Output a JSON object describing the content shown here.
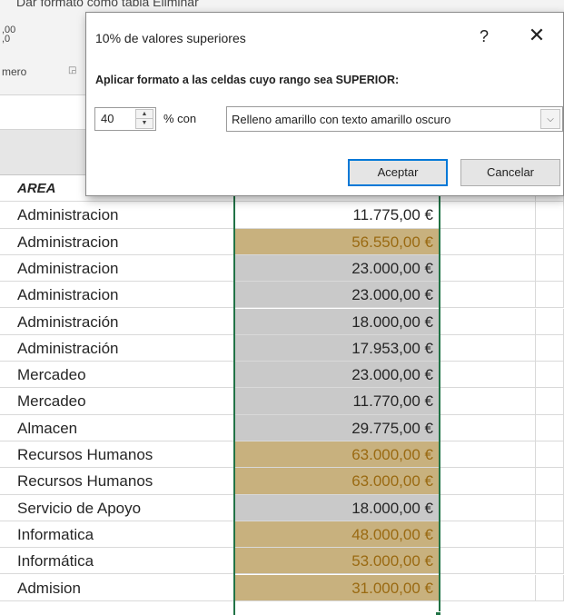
{
  "ribbon": {
    "top_cut_text": "Dar formato como tabla     Eliminar",
    "decimals_label": ",00\n,0",
    "group_label": "mero",
    "launcher_icon": "dialog-launcher-icon"
  },
  "dialog": {
    "title": "10% de valores superiores",
    "help_label": "?",
    "close_label": "✕",
    "prompt": "Aplicar formato a las celdas cuyo rango sea SUPERIOR:",
    "rank_value": "40",
    "pct_label": "% con",
    "format_value": "Relleno amarillo con texto amarillo oscuro",
    "ok_label": "Aceptar",
    "cancel_label": "Cancelar"
  },
  "sheet": {
    "header_area": "AREA",
    "rows": [
      {
        "area": "Administracion",
        "amount": "11.775,00 €",
        "fill": "none"
      },
      {
        "area": "Administracion",
        "amount": "56.550,00 €",
        "fill": "gold"
      },
      {
        "area": "Administracion",
        "amount": "23.000,00 €",
        "fill": "gray"
      },
      {
        "area": "Administracion",
        "amount": "23.000,00 €",
        "fill": "gray"
      },
      {
        "area": "Administración",
        "amount": "18.000,00 €",
        "fill": "gray"
      },
      {
        "area": "Administración",
        "amount": "17.953,00 €",
        "fill": "gray"
      },
      {
        "area": "Mercadeo",
        "amount": "23.000,00 €",
        "fill": "gray"
      },
      {
        "area": "Mercadeo",
        "amount": "11.770,00 €",
        "fill": "gray"
      },
      {
        "area": "Almacen",
        "amount": "29.775,00 €",
        "fill": "gray"
      },
      {
        "area": "Recursos Humanos",
        "amount": "63.000,00 €",
        "fill": "gold"
      },
      {
        "area": "Recursos Humanos",
        "amount": "63.000,00 €",
        "fill": "gold"
      },
      {
        "area": "Servicio de Apoyo",
        "amount": "18.000,00 €",
        "fill": "gray"
      },
      {
        "area": "Informatica",
        "amount": "48.000,00 €",
        "fill": "gold"
      },
      {
        "area": "Informática",
        "amount": "53.000,00 €",
        "fill": "gold"
      },
      {
        "area": "Admision",
        "amount": "31.000,00 €",
        "fill": "gold"
      }
    ]
  },
  "colors": {
    "gold_fill": "#c8b17e",
    "gold_text": "#9a6a12",
    "gray_fill": "#c9c9c9",
    "selection": "#217346",
    "ok_focus": "#0078d7"
  }
}
